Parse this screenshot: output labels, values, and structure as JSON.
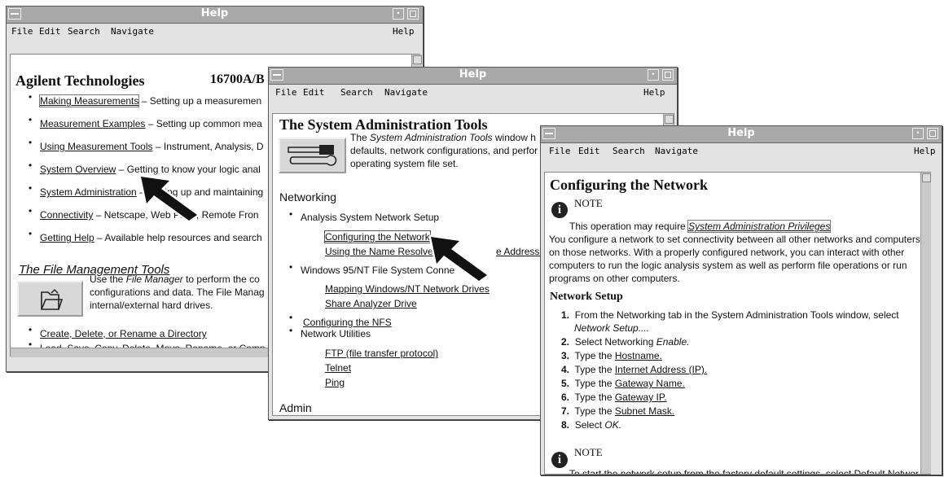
{
  "window_title": "Help",
  "menu": {
    "file": "File",
    "edit": "Edit",
    "search": "Search",
    "navigate": "Navigate",
    "help": "Help"
  },
  "win1": {
    "company": "Agilent Technologies",
    "model": "16700A/B",
    "items": [
      {
        "link": "Making Measurements",
        "desc": "– Setting up a measuremen"
      },
      {
        "link": "Measurement Examples",
        "desc": "– Setting up common mea"
      },
      {
        "link": "Using Measurement Tools",
        "desc": "– Instrument, Analysis, D"
      },
      {
        "link": "System Overview",
        "desc": "– Getting to know your logic anal"
      },
      {
        "link": "System Administration",
        "desc": "– Setting up and maintaining"
      },
      {
        "link": "Connectivity",
        "desc": "– Netscape, Web Page, Remote Fron"
      },
      {
        "link": "Getting Help",
        "desc": "– Available help resources and search"
      }
    ],
    "section_title": "The File Management Tools",
    "section_text_1": "Use the",
    "section_text_em": "File Manager",
    "section_text_2": "to perform the co",
    "section_text_3": "configurations and data. The File Manag",
    "section_text_4": "internal/external hard drives.",
    "links2": [
      "Create, Delete, or Rename a Directory",
      "Load, Save, Copy, Delete, Move, Rename, or Comp"
    ]
  },
  "win2": {
    "title": "The System Administration Tools",
    "intro_1": "The",
    "intro_em": "System Administration Tools",
    "intro_2": "window h",
    "intro_3": "defaults, network configurations, and perfor",
    "intro_4": "operating system file set.",
    "networking": "Networking",
    "analysis": "Analysis System Network Setup",
    "sub1": [
      "Configuring the Network",
      "Using the Name Resolver",
      "e Addresses"
    ],
    "windows": "Windows 95/NT File System Conne",
    "sub2": [
      "Mapping Windows/NT Network Drives",
      "Share Analyzer Drive"
    ],
    "nfs": "Configuring the NFS",
    "utilities": "Network Utilities",
    "sub3": [
      "FTP (file transfer protocol)",
      "Telnet",
      "Ping"
    ],
    "admin": "Admin"
  },
  "win3": {
    "title": "Configuring the Network",
    "note": "NOTE",
    "note_text": "This operation may require",
    "note_link": "System Administration Privileges",
    "para": [
      "You configure a network to set connectivity between all other networks and computers",
      "on those networks. With a properly configured network, you can interact with other",
      "computers to run the logic analysis system as well as perform file operations or run",
      "programs on other computers."
    ],
    "subtitle": "Network  Setup",
    "steps": [
      {
        "n": "1.",
        "a": "From the Networking tab in the System Administration Tools window, select",
        "b": ""
      },
      {
        "n": "",
        "a": "",
        "b": "Network Setup...."
      },
      {
        "n": "2.",
        "a": "Select Networking",
        "b": "Enable."
      },
      {
        "n": "3.",
        "a": "Type the",
        "b": "Hostname."
      },
      {
        "n": "4.",
        "a": "Type the",
        "b": "Internet Address (IP)."
      },
      {
        "n": "5.",
        "a": "Type the",
        "b": "Gateway Name."
      },
      {
        "n": "6.",
        "a": "Type the",
        "b": "Gateway IP."
      },
      {
        "n": "7.",
        "a": "Type the",
        "b": "Subnet Mask."
      },
      {
        "n": "8.",
        "a": "Select",
        "b": "OK."
      }
    ],
    "note2": "NOTE",
    "cut_text": "To start the network setup from the factory default settings, select Default Networ"
  }
}
